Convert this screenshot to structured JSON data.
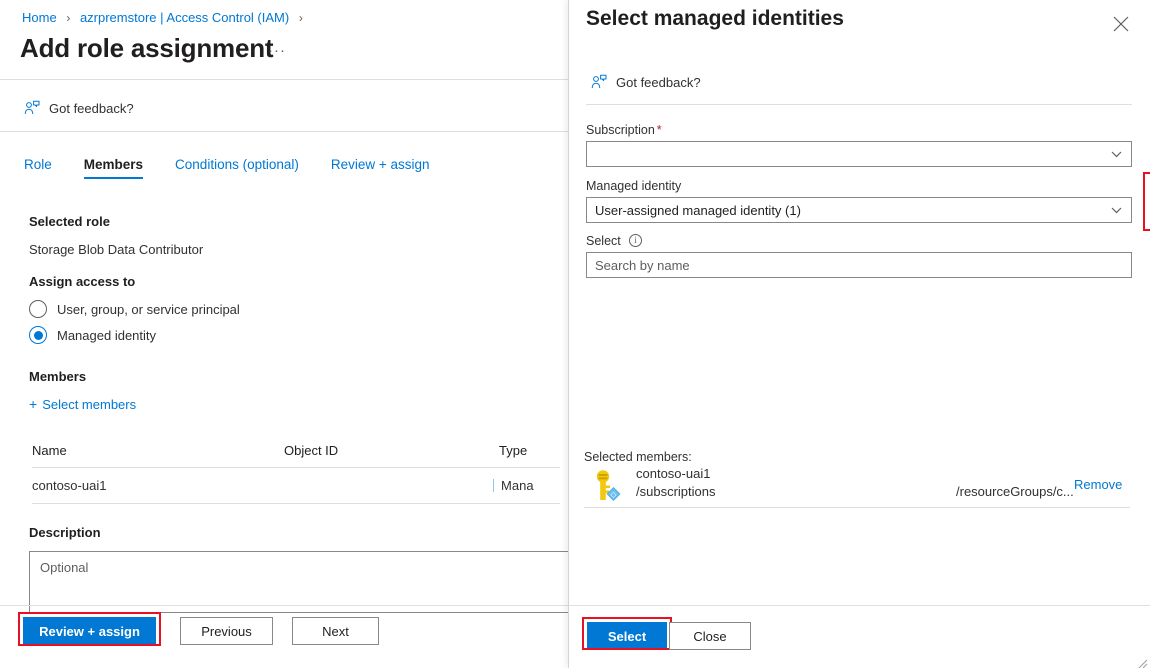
{
  "left_page": {
    "breadcrumb": {
      "items": [
        "Home",
        "azrpremstore | Access Control (IAM)"
      ],
      "separator": "›"
    },
    "title": "Add role assignment",
    "more_actions": "···",
    "feedback": {
      "label": "Got feedback?",
      "icon": "feedback-person-icon"
    },
    "tabs": [
      {
        "label": "Role",
        "active": false
      },
      {
        "label": "Members",
        "active": true
      },
      {
        "label": "Conditions (optional)",
        "active": false
      },
      {
        "label": "Review + assign",
        "active": false
      }
    ],
    "selected_role": {
      "heading": "Selected role",
      "value": "Storage Blob Data Contributor"
    },
    "assign_access_to": {
      "heading": "Assign access to",
      "options": [
        {
          "label": "User, group, or service principal",
          "selected": false
        },
        {
          "label": "Managed identity",
          "selected": true
        }
      ]
    },
    "members": {
      "heading": "Members",
      "select_members_link": "Select members",
      "plus_icon": "+",
      "columns": [
        "Name",
        "Object ID",
        "Type"
      ],
      "rows": [
        {
          "name": "contoso-uai1",
          "object_id": "",
          "type": "Mana"
        }
      ]
    },
    "description": {
      "heading": "Description",
      "placeholder": "Optional",
      "value": ""
    },
    "footer_buttons": [
      {
        "label": "Review + assign",
        "style": "primary",
        "highlighted": true
      },
      {
        "label": "Previous",
        "style": "secondary",
        "highlighted": false
      },
      {
        "label": "Next",
        "style": "secondary",
        "highlighted": false
      }
    ]
  },
  "right_panel": {
    "title": "Select managed identities",
    "close_icon": "close-icon",
    "feedback": {
      "label": "Got feedback?",
      "icon": "feedback-person-icon"
    },
    "subscription": {
      "label": "Subscription",
      "required_marker": "*",
      "value": "",
      "chevron": "chevron-down-icon"
    },
    "managed_identity": {
      "label": "Managed identity",
      "value": "User-assigned managed identity (1)",
      "chevron": "chevron-down-icon",
      "highlighted": true
    },
    "select_field": {
      "label": "Select",
      "info_icon": "ℹ",
      "placeholder": "Search by name",
      "value": ""
    },
    "selected_members": {
      "label": "Selected members:",
      "rows": [
        {
          "icon": "managed-identity-key-icon",
          "name": "contoso-uai1",
          "subscription_path": "/subscriptions",
          "resource_path": "/resourceGroups/c...",
          "remove_label": "Remove"
        }
      ]
    },
    "footer_buttons": [
      {
        "label": "Select",
        "style": "primary",
        "highlighted": true
      },
      {
        "label": "Close",
        "style": "secondary",
        "highlighted": false
      }
    ]
  },
  "colors": {
    "accent": "#0078d4",
    "highlight_red": "#e81123",
    "text_primary": "#201f1e",
    "text_secondary": "#605e5c",
    "border": "#8a8886",
    "divider": "#e1dfdd",
    "key_icon_yellow": "#f2c811",
    "key_badge_blue": "#50b0e8"
  }
}
